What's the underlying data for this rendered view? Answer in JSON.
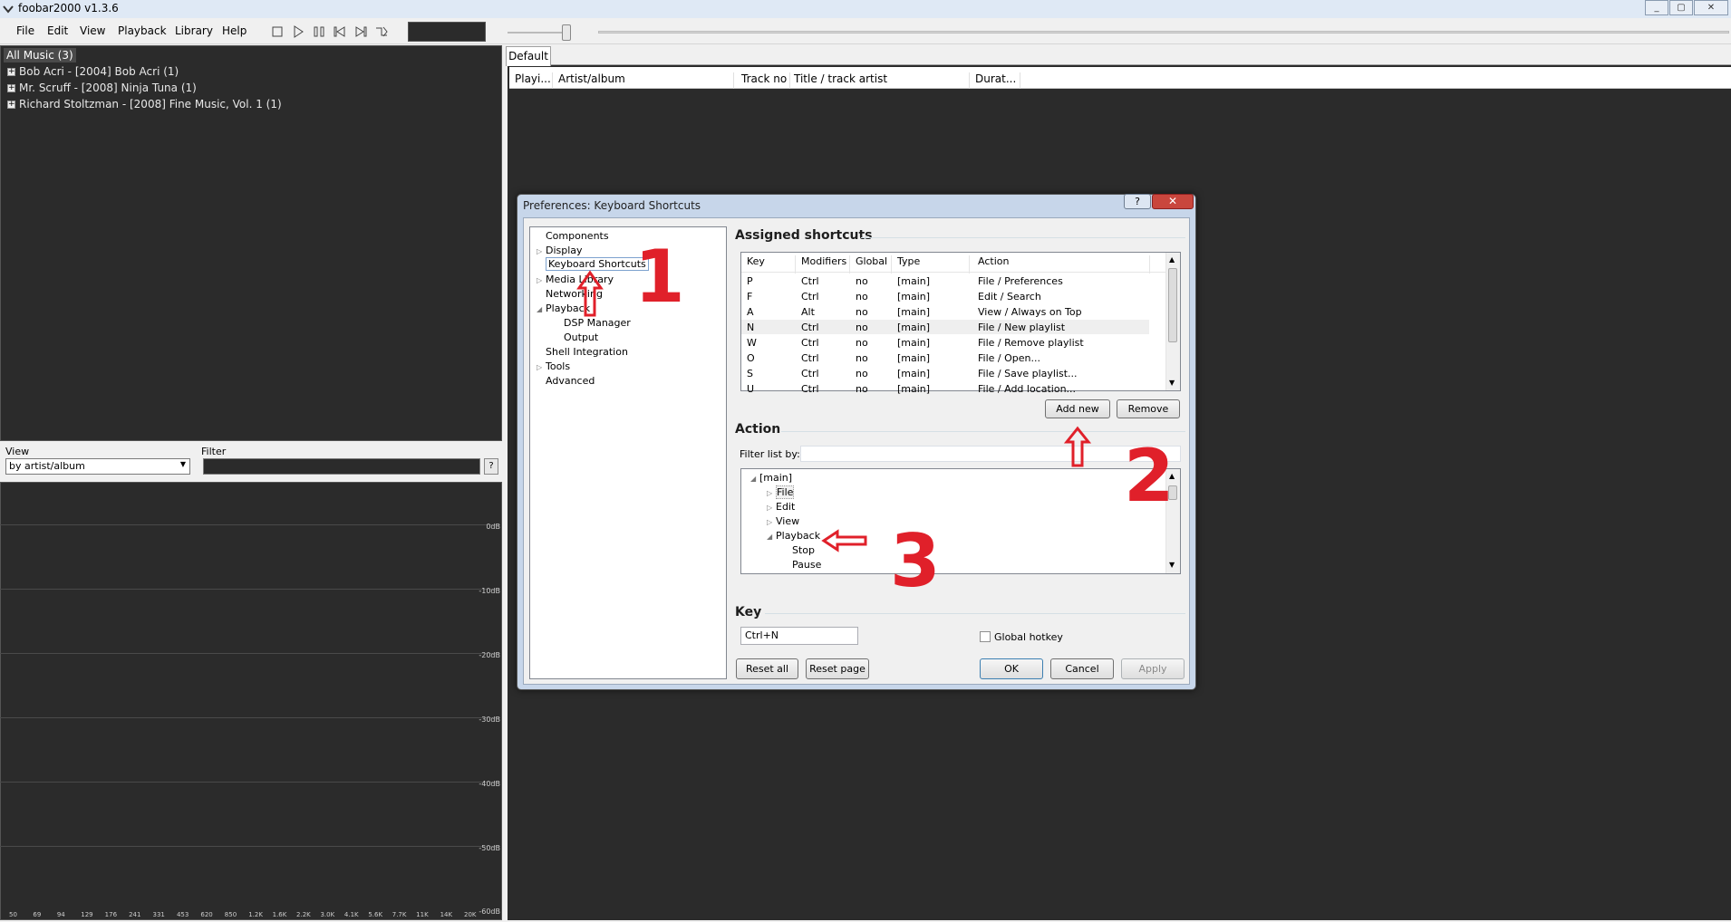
{
  "window": {
    "title": "foobar2000 v1.3.6"
  },
  "menu": [
    "File",
    "Edit",
    "View",
    "Playback",
    "Library",
    "Help"
  ],
  "library": {
    "root": "All Music (3)",
    "items": [
      "Bob Acri - [2004] Bob Acri (1)",
      "Mr. Scruff - [2008] Ninja Tuna (1)",
      "Richard Stoltzman - [2008] Fine Music, Vol. 1 (1)"
    ]
  },
  "view_filter": {
    "view_label": "View",
    "view_value": "by artist/album",
    "filter_label": "Filter",
    "help": "?"
  },
  "spectrum": {
    "db_labels": [
      "0dB",
      "-10dB",
      "-20dB",
      "-30dB",
      "-40dB",
      "-50dB",
      "-60dB"
    ],
    "freq_labels": [
      "50",
      "69",
      "94",
      "129",
      "176",
      "241",
      "331",
      "453",
      "620",
      "850",
      "1.2K",
      "1.6K",
      "2.2K",
      "3.0K",
      "4.1K",
      "5.6K",
      "7.7K",
      "11K",
      "14K",
      "20K"
    ]
  },
  "playlist": {
    "tab": "Default",
    "columns": [
      "Playi...",
      "Artist/album",
      "Track no",
      "Title / track artist",
      "Durat..."
    ]
  },
  "dialog": {
    "title": "Preferences: Keyboard Shortcuts",
    "help": "?",
    "close": "✕",
    "tree": [
      {
        "label": "Components",
        "arrow": ""
      },
      {
        "label": "Display",
        "arrow": "▷"
      },
      {
        "label": "Keyboard Shortcuts",
        "arrow": ""
      },
      {
        "label": "Media Library",
        "arrow": "▷"
      },
      {
        "label": "Networking",
        "arrow": ""
      },
      {
        "label": "Playback",
        "arrow": "◢"
      },
      {
        "label": "DSP Manager",
        "arrow": ""
      },
      {
        "label": "Output",
        "arrow": ""
      },
      {
        "label": "Shell Integration",
        "arrow": ""
      },
      {
        "label": "Tools",
        "arrow": "▷"
      },
      {
        "label": "Advanced",
        "arrow": ""
      }
    ],
    "assigned_title": "Assigned shortcuts",
    "shortcut_columns": [
      "Key",
      "Modifiers",
      "Global",
      "Type",
      "Action"
    ],
    "shortcuts": [
      [
        "P",
        "Ctrl",
        "no",
        "[main]",
        "File / Preferences"
      ],
      [
        "F",
        "Ctrl",
        "no",
        "[main]",
        "Edit / Search"
      ],
      [
        "A",
        "Alt",
        "no",
        "[main]",
        "View / Always on Top"
      ],
      [
        "N",
        "Ctrl",
        "no",
        "[main]",
        "File / New playlist"
      ],
      [
        "W",
        "Ctrl",
        "no",
        "[main]",
        "File / Remove playlist"
      ],
      [
        "O",
        "Ctrl",
        "no",
        "[main]",
        "File / Open..."
      ],
      [
        "S",
        "Ctrl",
        "no",
        "[main]",
        "File / Save playlist..."
      ],
      [
        "U",
        "Ctrl",
        "no",
        "[main]",
        "File / Add location..."
      ]
    ],
    "add_new": "Add new",
    "remove": "Remove",
    "action_title": "Action",
    "filter_list_label": "Filter list by:",
    "action_tree": [
      {
        "label": "[main]",
        "arrow": "◢"
      },
      {
        "label": "File",
        "arrow": "▷"
      },
      {
        "label": "Edit",
        "arrow": "▷"
      },
      {
        "label": "View",
        "arrow": "▷"
      },
      {
        "label": "Playback",
        "arrow": "◢"
      },
      {
        "label": "Stop",
        "arrow": ""
      },
      {
        "label": "Pause",
        "arrow": ""
      }
    ],
    "key_title": "Key",
    "key_value": "Ctrl+N",
    "global_hotkey": "Global hotkey",
    "reset_all": "Reset all",
    "reset_page": "Reset page",
    "ok": "OK",
    "cancel": "Cancel",
    "apply": "Apply"
  },
  "annotations": [
    "1",
    "2",
    "3"
  ],
  "annotation_color": "#e0202a"
}
